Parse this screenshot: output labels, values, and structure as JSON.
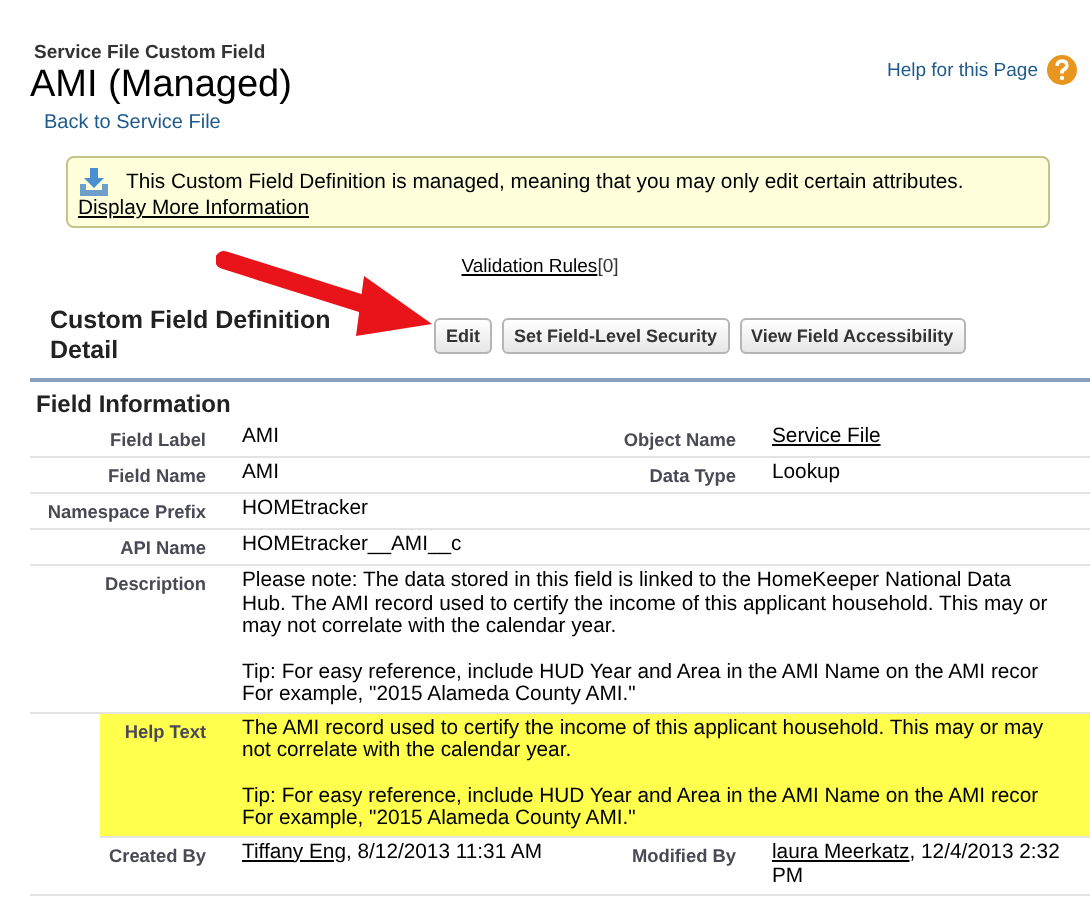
{
  "header": {
    "object_type": "Service File Custom Field",
    "title": "AMI (Managed)",
    "back_link": "Back to Service File",
    "help_link": "Help for this Page"
  },
  "notice": {
    "message": "This Custom Field Definition is managed, meaning that you may only edit certain attributes.",
    "link": "Display More Information"
  },
  "related_link": {
    "label": "Validation Rules",
    "count": "[0]"
  },
  "detail": {
    "title": "Custom Field Definition Detail",
    "buttons": [
      "Edit",
      "Set Field-Level Security",
      "View Field Accessibility"
    ]
  },
  "section": {
    "title": "Field Information"
  },
  "rows": [
    {
      "kind": "pair",
      "highlighted": false,
      "label": "Field Label",
      "value": {
        "text": "AMI"
      },
      "label2": "Object Name",
      "value2": {
        "link": "Service File"
      }
    },
    {
      "kind": "pair",
      "highlighted": false,
      "label": "Field Name",
      "value": {
        "text": "AMI"
      },
      "label2": "Data Type",
      "value2": {
        "text": "Lookup"
      }
    },
    {
      "kind": "single",
      "highlighted": false,
      "label": "Namespace Prefix",
      "value": {
        "text": "HOMEtracker"
      }
    },
    {
      "kind": "single",
      "highlighted": false,
      "label": "API Name",
      "value": {
        "text": "HOMEtracker__AMI__c"
      }
    },
    {
      "kind": "paragraphs",
      "highlighted": false,
      "label": "Description",
      "paragraphs": [
        [
          "Please note: The data stored in this field is linked to the HomeKeeper National Data",
          "Hub. The AMI record used to certify the income of this applicant household. This may or",
          "may not correlate with the calendar year."
        ],
        [
          "Tip: For easy reference, include HUD Year and Area in the AMI Name on the AMI recor",
          "For example, \"2015 Alameda County AMI.\""
        ]
      ]
    },
    {
      "kind": "paragraphs",
      "highlighted": true,
      "label": "Help Text",
      "paragraphs": [
        [
          "The AMI record used to certify the income of this applicant household. This may or may",
          "not correlate with the calendar year."
        ],
        [
          "Tip: For easy reference, include HUD Year and Area in the AMI Name on the AMI recor",
          "For example, \"2015 Alameda County AMI.\""
        ]
      ]
    },
    {
      "kind": "pair",
      "highlighted": false,
      "label": "Created By",
      "value": {
        "link": "Tiffany Eng",
        "text": ", 8/12/2013 11:31 AM"
      },
      "label2": "Modified By",
      "value2": {
        "link": "laura Meerkatz",
        "text": ", 12/4/2013 2:32",
        "continuation": "PM"
      }
    }
  ]
}
